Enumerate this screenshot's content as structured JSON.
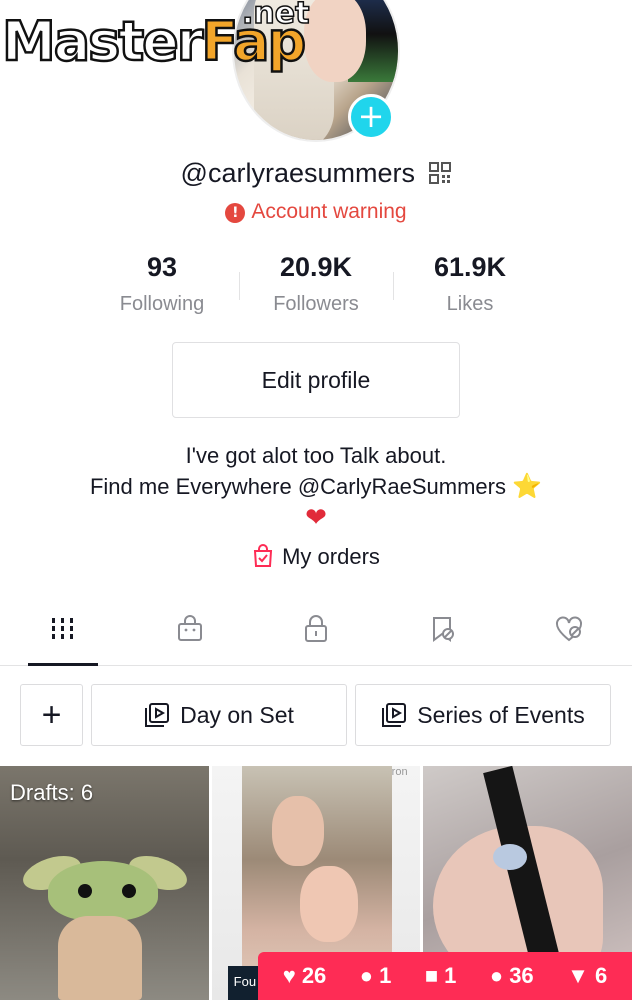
{
  "watermark": {
    "main_a": "Master",
    "main_b": "Fap",
    "net": ".net"
  },
  "profile": {
    "username": "@carlyraesummers",
    "warning": "Account warning",
    "stats": [
      {
        "value": "93",
        "label": "Following"
      },
      {
        "value": "20.9K",
        "label": "Followers"
      },
      {
        "value": "61.9K",
        "label": "Likes"
      }
    ],
    "edit_label": "Edit profile",
    "bio_line1": "I've got alot too Talk about.",
    "bio_line2": "Find me Everywhere @CarlyRaeSummers",
    "bio_emoji_star": "⭐",
    "bio_emoji_heart": "❤",
    "orders_label": "My orders"
  },
  "tabs": [
    {
      "icon": "grid-icon",
      "active": true
    },
    {
      "icon": "shopping-bag-icon",
      "active": false
    },
    {
      "icon": "lock-icon",
      "active": false
    },
    {
      "icon": "bookmark-hidden-icon",
      "active": false
    },
    {
      "icon": "heart-hidden-icon",
      "active": false
    }
  ],
  "playlists": {
    "add": "+",
    "items": [
      "Day on Set",
      "Series of Events"
    ]
  },
  "videos": {
    "drafts": "Drafts: 6",
    "cell2_top_text": "ron",
    "cell2_corner_text": "Fou"
  },
  "stats_bar": {
    "likes": "26",
    "comments": "1",
    "questions": "1",
    "followers": "36",
    "shares": "6"
  },
  "colors": {
    "accent": "#fe2c55",
    "warning": "#e4483f",
    "teal": "#20d5ec"
  }
}
